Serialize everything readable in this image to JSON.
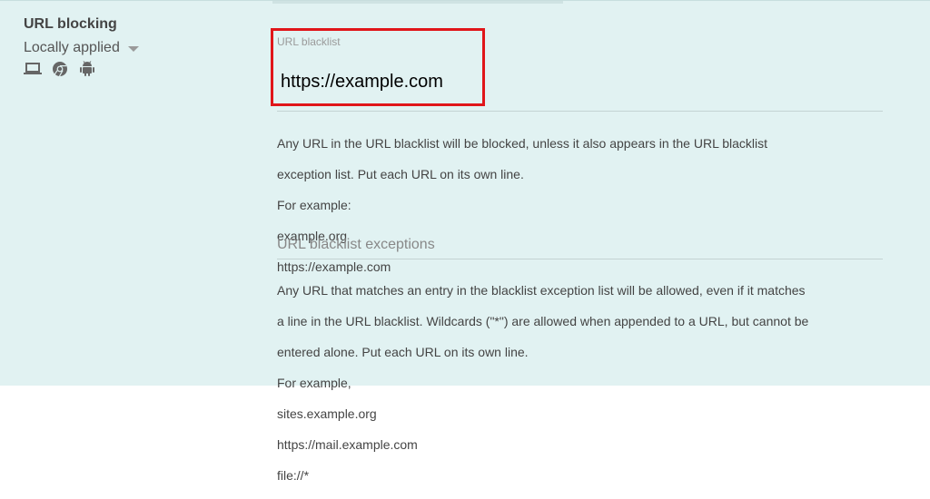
{
  "setting": {
    "title": "URL blocking",
    "scope_label": "Locally applied",
    "platforms": [
      "laptop-icon",
      "chrome-icon",
      "android-icon"
    ]
  },
  "blacklist": {
    "label": "URL blacklist",
    "value": "https://example.com",
    "help_lines": [
      "Any URL in the URL blacklist will be blocked, unless it also appears in the URL blacklist",
      "exception list. Put each URL on its own line.",
      "For example:",
      "example.org",
      "https://example.com"
    ]
  },
  "exceptions": {
    "title": "URL blacklist exceptions",
    "help_lines": [
      "Any URL that matches an entry in the blacklist exception list will be allowed, even if it matches",
      "a line in the URL blacklist. Wildcards (\"*\") are allowed when appended to a URL, but cannot be",
      "entered alone. Put each URL on its own line.",
      "For example,",
      "sites.example.org",
      "https://mail.example.com",
      "file://*"
    ]
  },
  "colors": {
    "panel_bg": "#e1f2f2",
    "highlight": "#e0161a",
    "icon": "#666666"
  }
}
